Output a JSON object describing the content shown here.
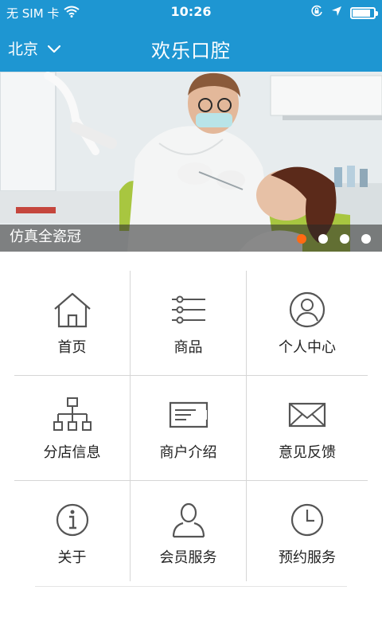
{
  "status_bar": {
    "carrier": "无 SIM 卡",
    "time": "10:26",
    "battery_level": 0.8,
    "icons": [
      "wifi-icon",
      "orientation-lock-icon",
      "location-arrow-icon",
      "battery-icon"
    ]
  },
  "header": {
    "city": "北京",
    "title": "欢乐口腔",
    "background_color": "#1e96d2"
  },
  "banner": {
    "caption": "仿真全瓷冠",
    "slide_count": 4,
    "active_slide": 1,
    "active_dot_color": "#ff6a13"
  },
  "menu": {
    "items": [
      {
        "label": "首页",
        "icon": "home-icon"
      },
      {
        "label": "商品",
        "icon": "list-icon"
      },
      {
        "label": "个人中心",
        "icon": "user-circle-icon"
      },
      {
        "label": "分店信息",
        "icon": "branch-tree-icon"
      },
      {
        "label": "商户介绍",
        "icon": "card-icon"
      },
      {
        "label": "意见反馈",
        "icon": "mail-icon"
      },
      {
        "label": "关于",
        "icon": "info-icon"
      },
      {
        "label": "会员服务",
        "icon": "member-icon"
      },
      {
        "label": "预约服务",
        "icon": "clock-icon"
      }
    ]
  }
}
